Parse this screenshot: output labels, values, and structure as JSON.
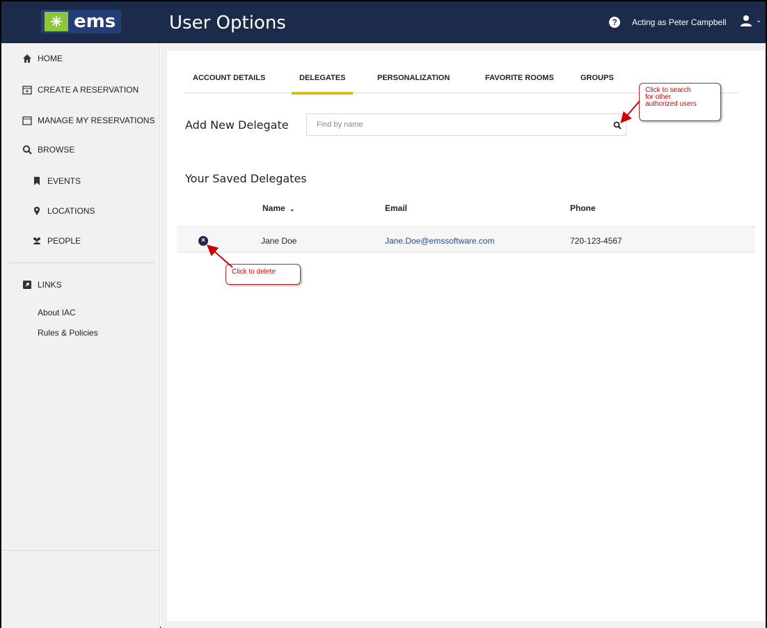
{
  "header": {
    "logo_text": "ems",
    "title": "User Options",
    "help_icon": "question-circle-icon",
    "acting_as": "Acting as Peter Campbell",
    "user_icon": "user-icon"
  },
  "sidebar": {
    "items": [
      {
        "label": "HOME",
        "icon": "home-icon"
      },
      {
        "label": "CREATE A RESERVATION",
        "icon": "calendar-plus-icon"
      },
      {
        "label": "MANAGE MY RESERVATIONS",
        "icon": "calendar-icon"
      },
      {
        "label": "BROWSE",
        "icon": "search-icon"
      },
      {
        "label": "EVENTS",
        "icon": "bookmark-icon"
      },
      {
        "label": "LOCATIONS",
        "icon": "map-marker-icon"
      },
      {
        "label": "PEOPLE",
        "icon": "users-icon"
      },
      {
        "label": "LINKS",
        "icon": "external-link-icon"
      }
    ],
    "links": [
      "About IAC",
      "Rules & Policies"
    ]
  },
  "tabs": [
    {
      "label": "ACCOUNT DETAILS",
      "active": false
    },
    {
      "label": "DELEGATES",
      "active": true
    },
    {
      "label": "PERSONALIZATION",
      "active": false
    },
    {
      "label": "FAVORITE ROOMS",
      "active": false
    },
    {
      "label": "GROUPS",
      "active": false
    }
  ],
  "add_delegate": {
    "label": "Add New Delegate",
    "placeholder": "Find by name"
  },
  "saved_delegates": {
    "title": "Your Saved Delegates",
    "columns": {
      "name": "Name",
      "sort_indicator": "⌄",
      "email": "Email",
      "phone": "Phone"
    },
    "rows": [
      {
        "name": "Jane Doe",
        "email": "Jane.Doe@emssoftware.com",
        "phone": "720-123-4567"
      }
    ]
  },
  "callouts": {
    "search": [
      "Click to search",
      "for other",
      "authorized users"
    ],
    "delete": "Click to delete"
  },
  "colors": {
    "header_bg": "#1c2b4a",
    "tab_accent": "#d4c11f",
    "callout_text": "#cc0000"
  }
}
